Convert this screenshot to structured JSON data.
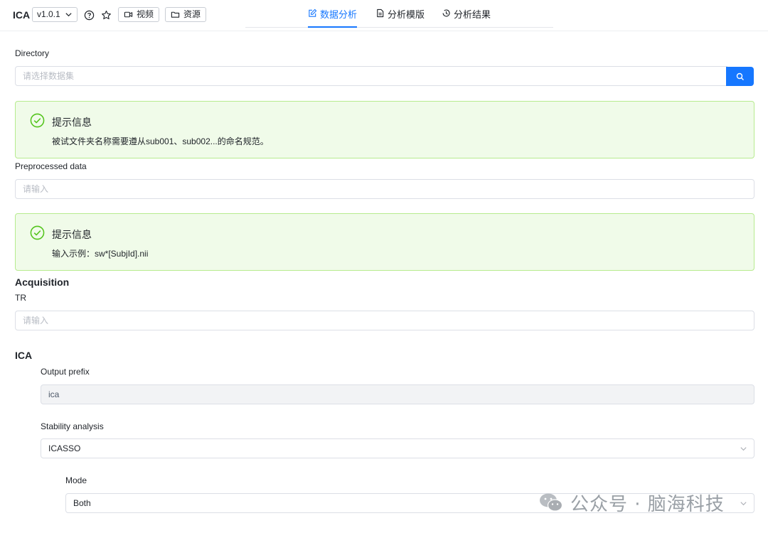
{
  "header": {
    "app_title": "ICA",
    "version": "v1.0.1",
    "video_label": "视频",
    "resources_label": "资源"
  },
  "tabs": [
    {
      "label": "数据分析",
      "active": true
    },
    {
      "label": "分析模版",
      "active": false
    },
    {
      "label": "分析结果",
      "active": false
    }
  ],
  "directory": {
    "label": "Directory",
    "placeholder": "请选择数据集"
  },
  "alert_dir": {
    "title": "提示信息",
    "desc": "被试文件夹名称需要遵从sub001、sub002...的命名规范。"
  },
  "preprocessed": {
    "label": "Preprocessed data",
    "placeholder": "请输入"
  },
  "alert_pre": {
    "title": "提示信息",
    "desc": "输入示例：sw*[SubjId].nii"
  },
  "acquisition": {
    "title": "Acquisition",
    "tr_label": "TR",
    "tr_placeholder": "请输入"
  },
  "ica": {
    "title": "ICA",
    "output_prefix_label": "Output prefix",
    "output_prefix_value": "ica",
    "stability_label": "Stability analysis",
    "stability_value": "ICASSO",
    "mode_label": "Mode",
    "mode_value": "Both"
  },
  "watermark": {
    "text": "公众号 · 脑海科技"
  },
  "colors": {
    "accent": "#1677ff",
    "success_bg": "#f0fbe9",
    "success_border": "#b7eb8f",
    "success_icon": "#52c41a"
  }
}
